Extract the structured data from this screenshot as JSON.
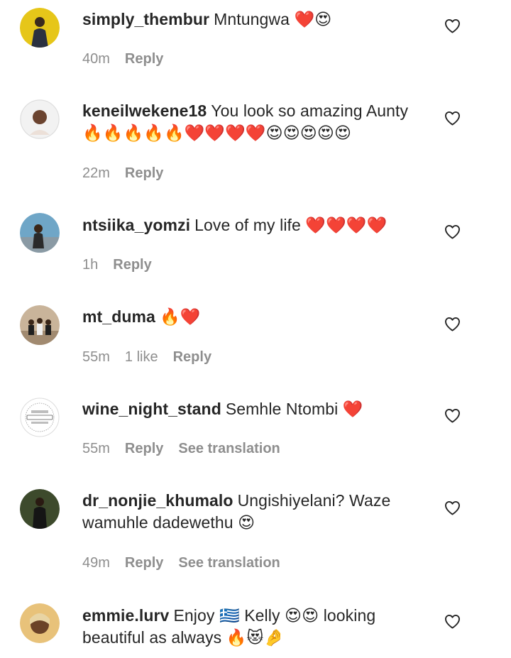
{
  "comments": [
    {
      "username": "simply_thembur",
      "text": "Mntungwa ❤️😍",
      "time": "40m",
      "likes": "",
      "reply": "Reply",
      "translate": ""
    },
    {
      "username": "keneilwekene18",
      "text": "You look so amazing Aunty 🔥🔥🔥🔥🔥❤️❤️❤️❤️😍😍😍😍😍",
      "time": "22m",
      "likes": "",
      "reply": "Reply",
      "translate": ""
    },
    {
      "username": "ntsiika_yomzi",
      "text": "Love of my life ❤️❤️❤️❤️",
      "time": "1h",
      "likes": "",
      "reply": "Reply",
      "translate": ""
    },
    {
      "username": "mt_duma",
      "text": "🔥❤️",
      "time": "55m",
      "likes": "1 like",
      "reply": "Reply",
      "translate": ""
    },
    {
      "username": "wine_night_stand",
      "text": "Semhle Ntombi ❤️",
      "time": "55m",
      "likes": "",
      "reply": "Reply",
      "translate": "See translation"
    },
    {
      "username": "dr_nonjie_khumalo",
      "text": "Ungishiyelani? Waze wamuhle dadewethu 😍",
      "time": "49m",
      "likes": "",
      "reply": "Reply",
      "translate": "See translation"
    },
    {
      "username": "emmie.lurv",
      "text": "Enjoy 🇬🇷 Kelly 😍😍 looking beautiful as always 🔥😻🤌",
      "time": "",
      "likes": "",
      "reply": "",
      "translate": ""
    }
  ],
  "icons": {
    "like": "heart-outline-icon"
  },
  "colors": {
    "primary_text": "#262626",
    "secondary_text": "#8e8e8e",
    "background": "#ffffff"
  }
}
